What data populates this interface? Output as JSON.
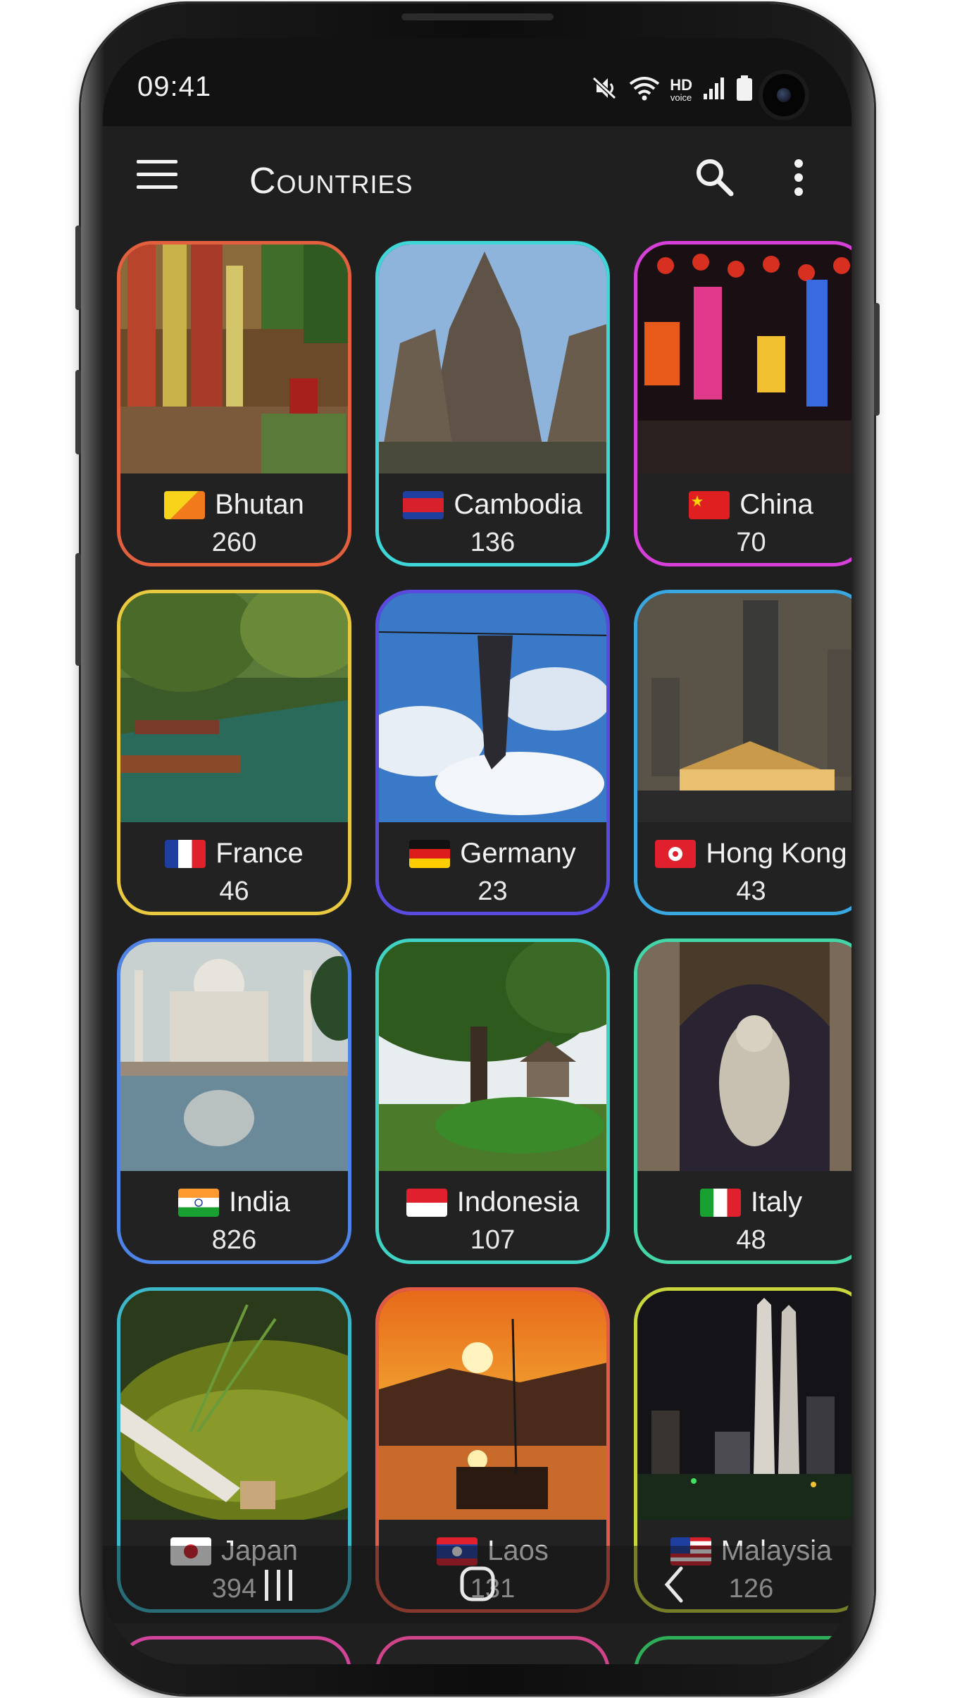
{
  "status_bar": {
    "time": "09:41",
    "icons": [
      "mute-icon",
      "wifi-icon",
      "hd-voice-icon",
      "signal-icon",
      "battery-icon"
    ],
    "hd_label": "HD",
    "voice_label": "voice"
  },
  "app_bar": {
    "title": "Countries",
    "menu_icon": "hamburger-menu-icon",
    "search_icon": "search-icon",
    "more_icon": "more-vertical-icon"
  },
  "countries": [
    {
      "name": "Bhutan",
      "count": "260",
      "border": "#e3603f",
      "flag": "bhutan-flag-icon"
    },
    {
      "name": "Cambodia",
      "count": "136",
      "border": "#3fd6d8",
      "flag": "cambodia-flag-icon"
    },
    {
      "name": "China",
      "count": "70",
      "border": "#d640d9",
      "flag": "china-flag-icon"
    },
    {
      "name": "France",
      "count": "46",
      "border": "#e8c93f",
      "flag": "france-flag-icon"
    },
    {
      "name": "Germany",
      "count": "23",
      "border": "#5a4ae0",
      "flag": "germany-flag-icon"
    },
    {
      "name": "Hong Kong",
      "count": "43",
      "border": "#3aa7e0",
      "flag": "hong-kong-flag-icon"
    },
    {
      "name": "India",
      "count": "826",
      "border": "#4e84e8",
      "flag": "india-flag-icon"
    },
    {
      "name": "Indonesia",
      "count": "107",
      "border": "#3fd3c4",
      "flag": "indonesia-flag-icon"
    },
    {
      "name": "Italy",
      "count": "48",
      "border": "#45d6a8",
      "flag": "italy-flag-icon"
    },
    {
      "name": "Japan",
      "count": "394",
      "border": "#3cb8c8",
      "flag": "japan-flag-icon"
    },
    {
      "name": "Laos",
      "count": "131",
      "border": "#e35a45",
      "flag": "laos-flag-icon"
    },
    {
      "name": "Malaysia",
      "count": "126",
      "border": "#c8d63c",
      "flag": "malaysia-flag-icon"
    }
  ],
  "peek_borders": [
    "#d0459a",
    "#d0458a",
    "#2fae5a"
  ],
  "nav_bar": {
    "recents_icon": "recent-apps-icon",
    "home_icon": "home-icon",
    "back_icon": "back-icon"
  },
  "colors": {
    "background": "#1f1f1f",
    "status_bar": "#121212",
    "text": "#f2f2f2"
  }
}
